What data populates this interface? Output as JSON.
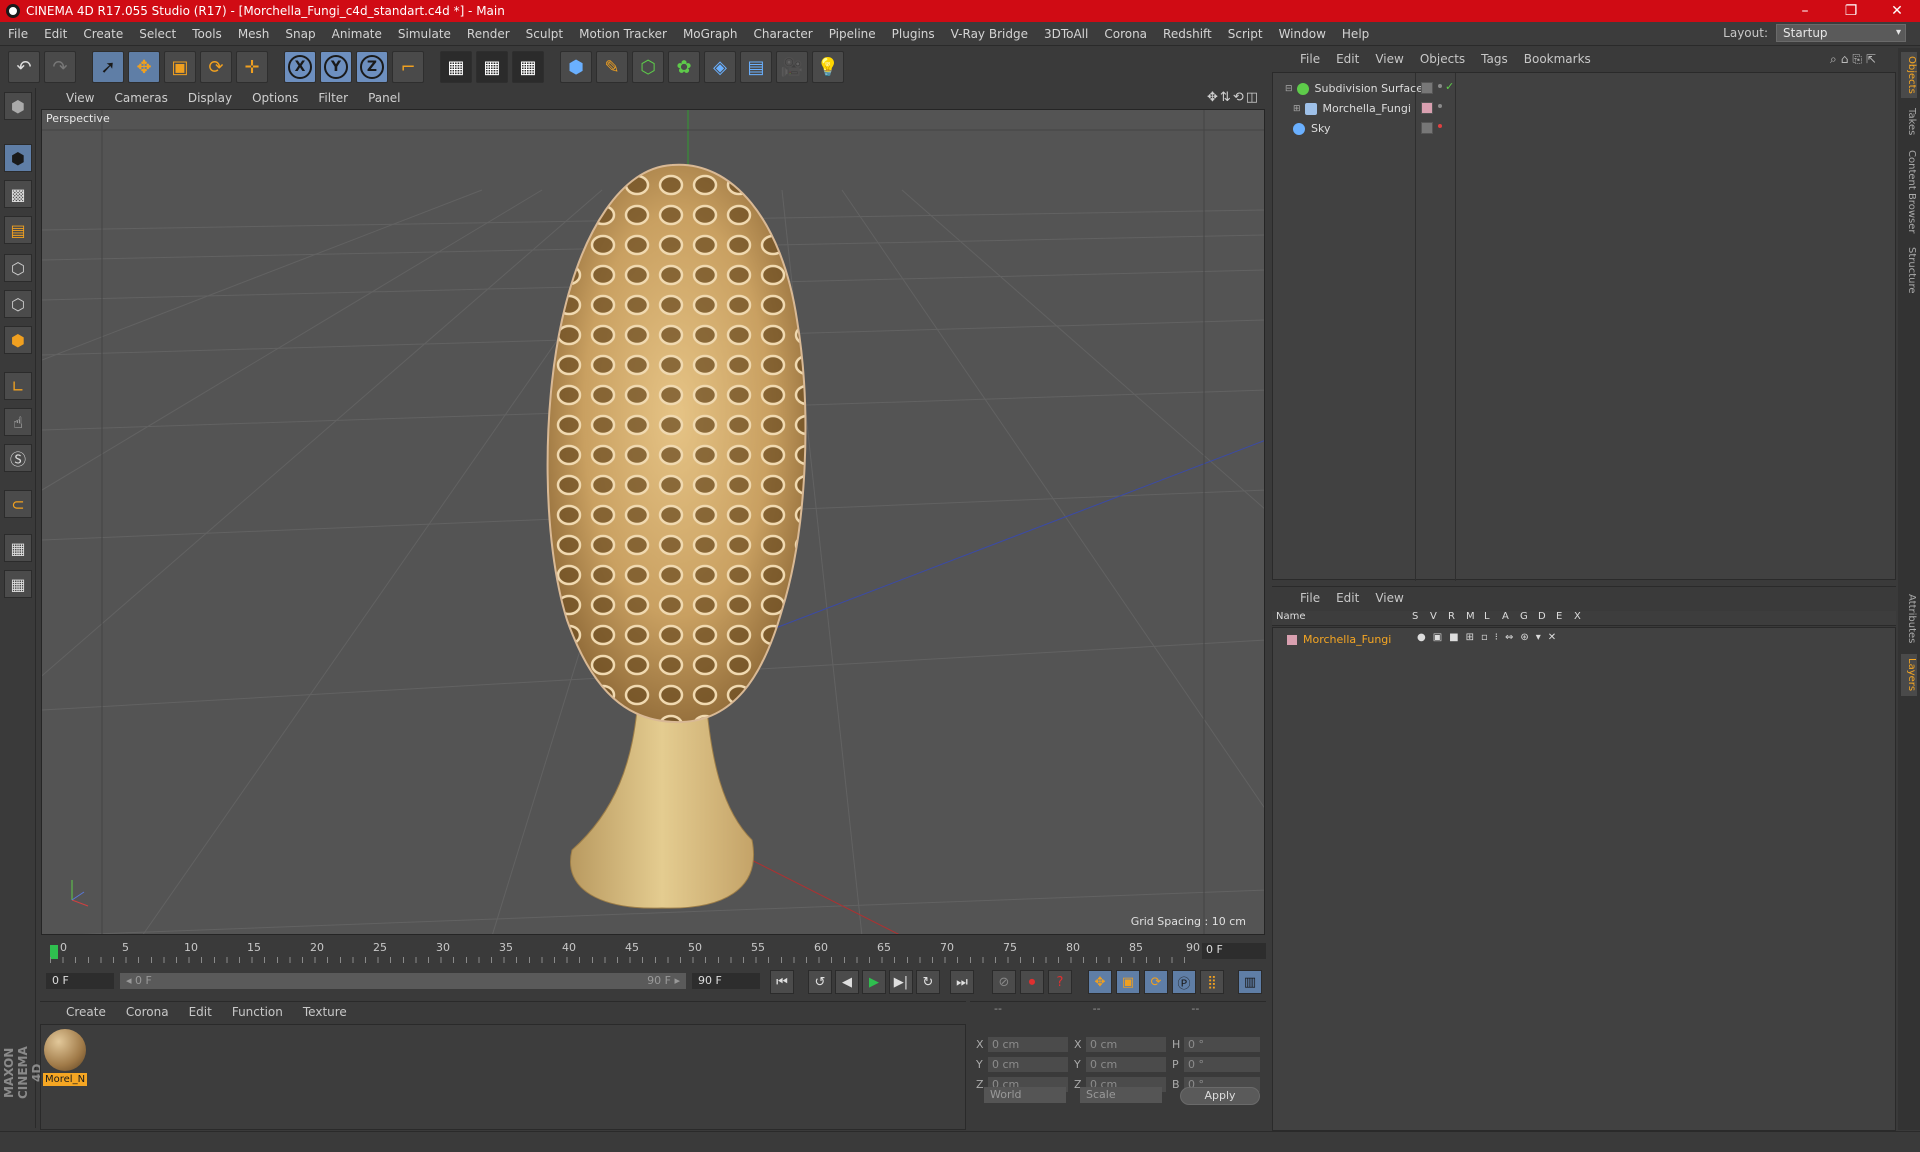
{
  "window": {
    "title": "CINEMA 4D R17.055 Studio (R17) - [Morchella_Fungi_c4d_standart.c4d *] - Main",
    "controls": [
      "–",
      "❐",
      "✕"
    ]
  },
  "menubar": {
    "items": [
      "File",
      "Edit",
      "Create",
      "Select",
      "Tools",
      "Mesh",
      "Snap",
      "Animate",
      "Simulate",
      "Render",
      "Sculpt",
      "Motion Tracker",
      "MoGraph",
      "Character",
      "Pipeline",
      "Plugins",
      "V-Ray Bridge",
      "3DToAll",
      "Corona",
      "Redshift",
      "Script",
      "Window",
      "Help"
    ],
    "layout_label": "Layout:",
    "layout_value": "Startup"
  },
  "toolbar": {
    "axis_x": "X",
    "axis_y": "Y",
    "axis_z": "Z"
  },
  "viewport": {
    "menu": [
      "View",
      "Cameras",
      "Display",
      "Options",
      "Filter",
      "Panel"
    ],
    "label": "Perspective",
    "grid_spacing": "Grid Spacing : 10 cm",
    "nav_icons": "✥⇅⟲◫"
  },
  "timeline": {
    "ticks": [
      "0",
      "5",
      "10",
      "15",
      "20",
      "25",
      "30",
      "35",
      "40",
      "45",
      "50",
      "55",
      "60",
      "65",
      "70",
      "75",
      "80",
      "85",
      "90"
    ],
    "current_frame": "0 F"
  },
  "transport": {
    "start_field": "0 F",
    "slider_start": "◂ 0 F",
    "slider_end": "90 F ▸",
    "end_field": "90 F"
  },
  "materials": {
    "menu": [
      "Create",
      "Corona",
      "Edit",
      "Function",
      "Texture"
    ],
    "items": [
      {
        "name": "Morel_N"
      }
    ]
  },
  "coordinates": {
    "head": [
      "--",
      "--",
      "--"
    ],
    "rows": [
      {
        "l1": "X",
        "v1": "0 cm",
        "l2": "X",
        "v2": "0 cm",
        "l3": "H",
        "v3": "0 °"
      },
      {
        "l1": "Y",
        "v1": "0 cm",
        "l2": "Y",
        "v2": "0 cm",
        "l3": "P",
        "v3": "0 °"
      },
      {
        "l1": "Z",
        "v1": "0 cm",
        "l2": "Z",
        "v2": "0 cm",
        "l3": "B",
        "v3": "0 °"
      }
    ],
    "world": "World",
    "scale": "Scale",
    "apply": "Apply"
  },
  "objects_panel": {
    "menu": [
      "File",
      "Edit",
      "View",
      "Objects",
      "Tags",
      "Bookmarks"
    ],
    "items": [
      {
        "name": "Subdivision Surface",
        "color": "#5ecb4a"
      },
      {
        "name": "Morchella_Fungi",
        "color": "#9ec0e8"
      },
      {
        "name": "Sky",
        "color": "#6ab0ff"
      }
    ]
  },
  "layers_panel": {
    "menu": [
      "File",
      "Edit",
      "View"
    ],
    "columns": [
      "Name",
      "S",
      "V",
      "R",
      "M",
      "L",
      "A",
      "G",
      "D",
      "E",
      "X"
    ],
    "items": [
      {
        "name": "Morchella_Fungi",
        "color": "#f5a623"
      }
    ]
  },
  "right_tabs": [
    "Objects",
    "Takes",
    "Content Browser",
    "Structure",
    "Attributes",
    "Layers"
  ],
  "colors": {
    "titlebar": "#d00b14",
    "accent_orange": "#f5a623",
    "active_blue": "#5f7ea6"
  }
}
